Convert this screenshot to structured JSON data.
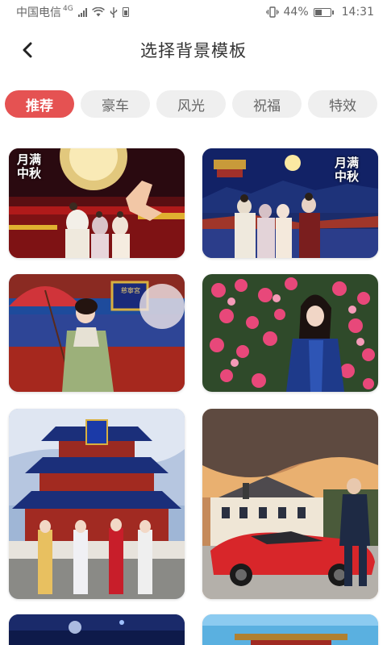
{
  "status_bar": {
    "carrier": "中国电信",
    "network": "4G",
    "battery": "44%",
    "time": "14:31"
  },
  "header": {
    "title": "选择背景模板"
  },
  "tabs": [
    {
      "label": "推荐",
      "active": true
    },
    {
      "label": "豪车",
      "active": false
    },
    {
      "label": "风光",
      "active": false
    },
    {
      "label": "祝福",
      "active": false
    },
    {
      "label": "特效",
      "active": false
    }
  ],
  "templates": {
    "t1": {
      "title_lines": [
        "月满",
        "中秋"
      ]
    },
    "t2": {
      "title_lines": [
        "月满",
        "中秋"
      ]
    },
    "t3": {
      "plaque": "慈寧宮"
    }
  },
  "colors": {
    "accent": "#e55252",
    "tab_bg": "#efefef"
  }
}
